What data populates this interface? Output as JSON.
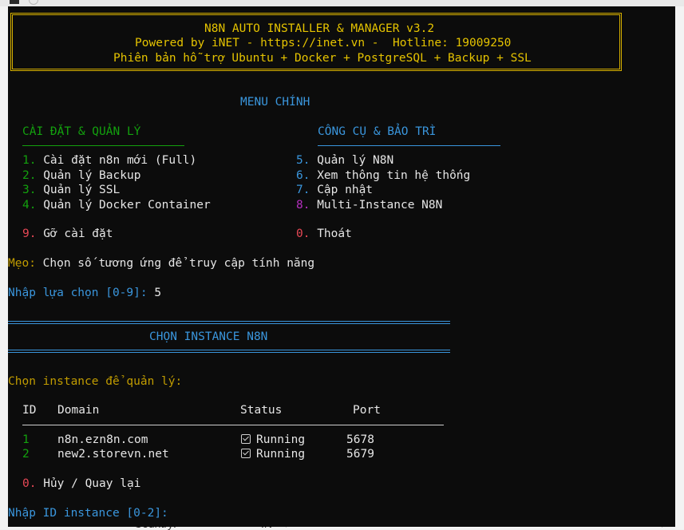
{
  "background": {
    "field_label": "Country:",
    "field_value": "IN"
  },
  "header": {
    "title": "N8N AUTO INSTALLER & MANAGER v3.2",
    "powered": "Powered by iNET - https://inet.vn -  Hotline: 19009250",
    "support": "Phiên bản hỗ trợ Ubuntu + Docker + PostgreSQL + Backup + SSL"
  },
  "menu": {
    "title": "MENU CHÍNH",
    "left_heading": "CÀI ĐẶT & QUẢN LÝ",
    "right_heading": "CÔNG CỤ & BẢO TRÌ",
    "left_items": [
      {
        "num": "1.",
        "label": "Cài đặt n8n mới (Full)"
      },
      {
        "num": "2.",
        "label": "Quản lý Backup"
      },
      {
        "num": "3.",
        "label": "Quản lý SSL"
      },
      {
        "num": "4.",
        "label": "Quản lý Docker Container"
      }
    ],
    "right_items": [
      {
        "num": "5.",
        "label": "Quản lý N8N"
      },
      {
        "num": "6.",
        "label": "Xem thông tin hệ thống"
      },
      {
        "num": "7.",
        "label": "Cập nhật"
      },
      {
        "num": "8.",
        "label": "Multi-Instance N8N"
      }
    ],
    "uninstall": {
      "num": "9.",
      "label": "Gỡ cài đặt"
    },
    "exit": {
      "num": "0.",
      "label": "Thoát"
    },
    "tip_label": "Mẹo:",
    "tip_text": " Chọn số tương ứng để truy cập tính năng",
    "prompt": "Nhập lựa chọn [0-9]:",
    "prompt_value": " 5"
  },
  "instance": {
    "title": "CHỌN INSTANCE N8N",
    "choose": "Chọn instance để quản lý:",
    "columns": {
      "id": "ID",
      "domain": "Domain",
      "status": "Status",
      "port": "Port"
    },
    "rows": [
      {
        "id": "1",
        "domain": "n8n.ezn8n.com",
        "status": "Running",
        "port": "5678"
      },
      {
        "id": "2",
        "domain": "new2.storevn.net",
        "status": "Running",
        "port": "5679"
      }
    ],
    "cancel": {
      "num": "0.",
      "label": "Hủy / Quay lại"
    },
    "prompt": "Nhập ID instance [0-2]:"
  }
}
